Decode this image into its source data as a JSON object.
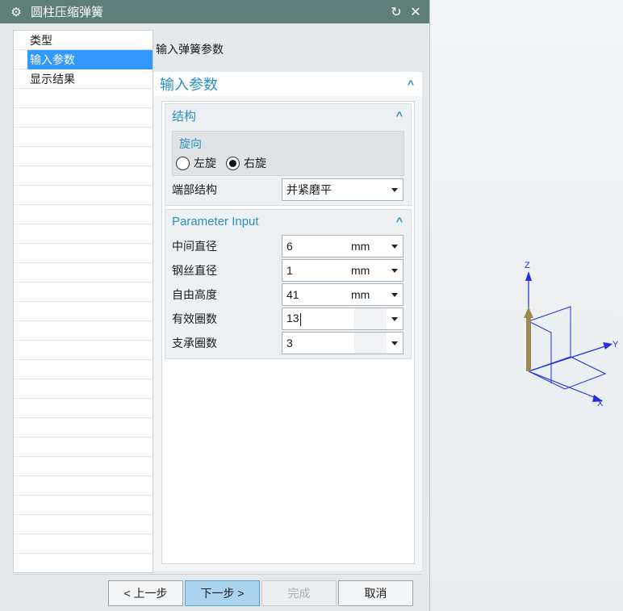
{
  "window": {
    "title": "圆柱压缩弹簧"
  },
  "steps": [
    "类型",
    "输入参数",
    "显示结果"
  ],
  "active_step": 1,
  "breadcrumb": "输入弹簧参数",
  "panel": {
    "title": "输入参数",
    "structure": {
      "title": "结构",
      "rotation": {
        "title": "旋向",
        "left_label": "左旋",
        "right_label": "右旋",
        "selected": "右旋"
      },
      "end_label": "端部结构",
      "end_value": "并紧磨平"
    },
    "params": {
      "title": "Parameter Input",
      "rows": [
        {
          "label": "中间直径",
          "value": "6",
          "unit": "mm"
        },
        {
          "label": "钢丝直径",
          "value": "1",
          "unit": "mm"
        },
        {
          "label": "自由高度",
          "value": "41",
          "unit": "mm"
        },
        {
          "label": "有效圈数",
          "value": "13",
          "unit": ""
        },
        {
          "label": "支承圈数",
          "value": "3",
          "unit": ""
        }
      ]
    }
  },
  "buttons": {
    "back": "< 上一步",
    "next": "下一步 >",
    "finish": "完成",
    "cancel": "取消"
  },
  "triad": {
    "x": "X",
    "y": "Y",
    "z": "Z"
  },
  "colors": {
    "titlebar": "#5e7e79",
    "accent": "#2a8fbf",
    "selection": "#3399ff"
  }
}
